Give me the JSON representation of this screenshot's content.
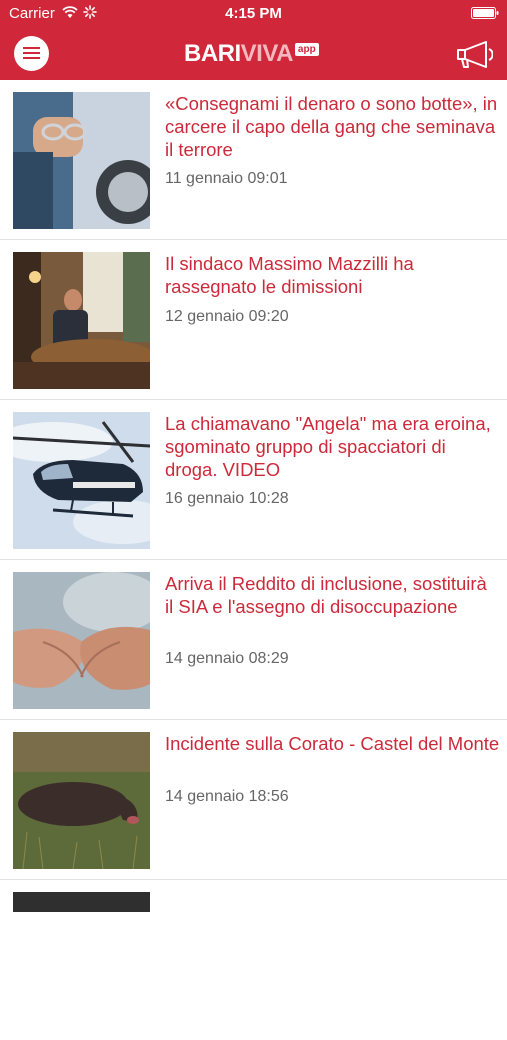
{
  "statusbar": {
    "carrier": "Carrier",
    "time": "4:15 PM"
  },
  "app": {
    "brand_color": "#d0283a",
    "logo_part1": "BARI",
    "logo_part2": "VIVA",
    "logo_badge": "app"
  },
  "icons": {
    "menu": "menu-icon",
    "megaphone": "megaphone-icon",
    "wifi": "wifi-icon",
    "battery": "battery-icon"
  },
  "feed": {
    "items": [
      {
        "title": "«Consegnami il denaro o sono botte», in carcere il capo della gang che seminava il terrore",
        "date": "11 gennaio 09:01",
        "thumb": "handcuffs-police-car"
      },
      {
        "title": "Il sindaco Massimo Mazzilli ha rassegnato le dimissioni",
        "date": "12 gennaio 09:20",
        "thumb": "mayor-office"
      },
      {
        "title": "La chiamavano \"Angela\" ma era eroina, sgominato gruppo di spacciatori di droga. VIDEO",
        "date": "16 gennaio 10:28",
        "thumb": "carabinieri-helicopter"
      },
      {
        "title": "Arriva il Reddito di inclusione, sostituirà il SIA e l'assegno di disoccupazione",
        "date": "14 gennaio 08:29",
        "thumb": "open-hands"
      },
      {
        "title": "Incidente sulla Corato - Castel del Monte",
        "date": "14 gennaio 18:56",
        "thumb": "boar-on-grass"
      }
    ]
  }
}
